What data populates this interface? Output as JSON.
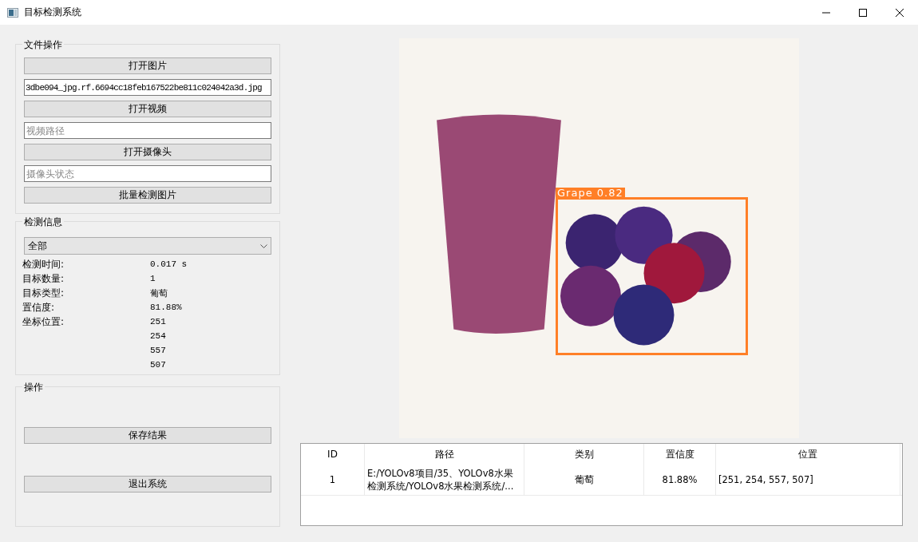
{
  "window": {
    "title": "目标检测系统"
  },
  "file_ops": {
    "title": "文件操作",
    "items": [
      {
        "kind": "button",
        "label": "打开图片"
      },
      {
        "kind": "field",
        "value": "3dbe094_jpg.rf.6694cc18feb167522be811c024042a3d.jpg"
      },
      {
        "kind": "button",
        "label": "打开视频"
      },
      {
        "kind": "field",
        "placeholder": "视频路径"
      },
      {
        "kind": "button",
        "label": "打开摄像头"
      },
      {
        "kind": "field",
        "placeholder": "摄像头状态"
      },
      {
        "kind": "button",
        "label": "批量检测图片"
      }
    ]
  },
  "detection_info": {
    "title": "检测信息",
    "filter": {
      "value": "全部"
    },
    "rows": [
      {
        "label": "检测时间:",
        "value": "0.017 s"
      },
      {
        "label": "目标数量:",
        "value": "1"
      },
      {
        "label": "目标类型:",
        "value": "葡萄"
      },
      {
        "label": "置信度:",
        "value": "81.88%"
      },
      {
        "label": "坐标位置:",
        "value": "251"
      },
      {
        "label": "",
        "value": "254"
      },
      {
        "label": "",
        "value": "557"
      },
      {
        "label": "",
        "value": "507"
      }
    ]
  },
  "operations": {
    "title": "操作",
    "buttons": [
      "保存结果",
      "退出系统"
    ]
  },
  "detection": {
    "label": "Grape 0.82"
  },
  "table": {
    "columns": [
      "ID",
      "路径",
      "类别",
      "置信度",
      "位置"
    ],
    "rows": [
      [
        "1",
        "E:/YOLOv8项目/35、YOLOv8水果检测系统/YOLOv8水果检测系统/...",
        "葡萄",
        "81.88%",
        "[251, 254, 557, 507]"
      ]
    ]
  }
}
